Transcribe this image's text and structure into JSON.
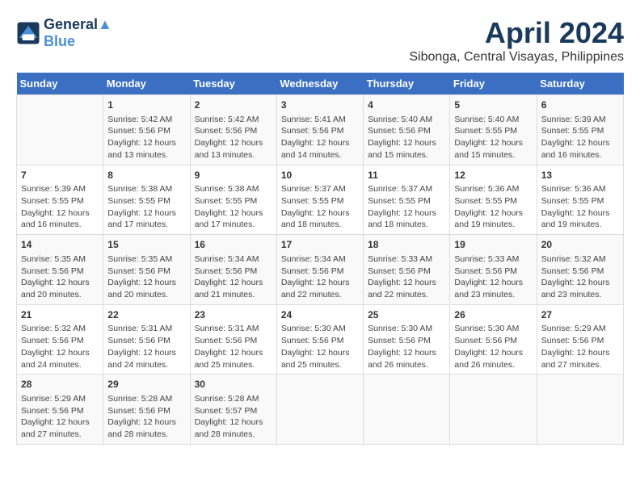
{
  "header": {
    "logo_line1": "General",
    "logo_line2": "Blue",
    "month": "April 2024",
    "location": "Sibonga, Central Visayas, Philippines"
  },
  "days_of_week": [
    "Sunday",
    "Monday",
    "Tuesday",
    "Wednesday",
    "Thursday",
    "Friday",
    "Saturday"
  ],
  "weeks": [
    [
      {
        "day": "",
        "content": ""
      },
      {
        "day": "1",
        "content": "Sunrise: 5:42 AM\nSunset: 5:56 PM\nDaylight: 12 hours\nand 13 minutes."
      },
      {
        "day": "2",
        "content": "Sunrise: 5:42 AM\nSunset: 5:56 PM\nDaylight: 12 hours\nand 13 minutes."
      },
      {
        "day": "3",
        "content": "Sunrise: 5:41 AM\nSunset: 5:56 PM\nDaylight: 12 hours\nand 14 minutes."
      },
      {
        "day": "4",
        "content": "Sunrise: 5:40 AM\nSunset: 5:56 PM\nDaylight: 12 hours\nand 15 minutes."
      },
      {
        "day": "5",
        "content": "Sunrise: 5:40 AM\nSunset: 5:55 PM\nDaylight: 12 hours\nand 15 minutes."
      },
      {
        "day": "6",
        "content": "Sunrise: 5:39 AM\nSunset: 5:55 PM\nDaylight: 12 hours\nand 16 minutes."
      }
    ],
    [
      {
        "day": "7",
        "content": "Sunrise: 5:39 AM\nSunset: 5:55 PM\nDaylight: 12 hours\nand 16 minutes."
      },
      {
        "day": "8",
        "content": "Sunrise: 5:38 AM\nSunset: 5:55 PM\nDaylight: 12 hours\nand 17 minutes."
      },
      {
        "day": "9",
        "content": "Sunrise: 5:38 AM\nSunset: 5:55 PM\nDaylight: 12 hours\nand 17 minutes."
      },
      {
        "day": "10",
        "content": "Sunrise: 5:37 AM\nSunset: 5:55 PM\nDaylight: 12 hours\nand 18 minutes."
      },
      {
        "day": "11",
        "content": "Sunrise: 5:37 AM\nSunset: 5:55 PM\nDaylight: 12 hours\nand 18 minutes."
      },
      {
        "day": "12",
        "content": "Sunrise: 5:36 AM\nSunset: 5:55 PM\nDaylight: 12 hours\nand 19 minutes."
      },
      {
        "day": "13",
        "content": "Sunrise: 5:36 AM\nSunset: 5:55 PM\nDaylight: 12 hours\nand 19 minutes."
      }
    ],
    [
      {
        "day": "14",
        "content": "Sunrise: 5:35 AM\nSunset: 5:56 PM\nDaylight: 12 hours\nand 20 minutes."
      },
      {
        "day": "15",
        "content": "Sunrise: 5:35 AM\nSunset: 5:56 PM\nDaylight: 12 hours\nand 20 minutes."
      },
      {
        "day": "16",
        "content": "Sunrise: 5:34 AM\nSunset: 5:56 PM\nDaylight: 12 hours\nand 21 minutes."
      },
      {
        "day": "17",
        "content": "Sunrise: 5:34 AM\nSunset: 5:56 PM\nDaylight: 12 hours\nand 22 minutes."
      },
      {
        "day": "18",
        "content": "Sunrise: 5:33 AM\nSunset: 5:56 PM\nDaylight: 12 hours\nand 22 minutes."
      },
      {
        "day": "19",
        "content": "Sunrise: 5:33 AM\nSunset: 5:56 PM\nDaylight: 12 hours\nand 23 minutes."
      },
      {
        "day": "20",
        "content": "Sunrise: 5:32 AM\nSunset: 5:56 PM\nDaylight: 12 hours\nand 23 minutes."
      }
    ],
    [
      {
        "day": "21",
        "content": "Sunrise: 5:32 AM\nSunset: 5:56 PM\nDaylight: 12 hours\nand 24 minutes."
      },
      {
        "day": "22",
        "content": "Sunrise: 5:31 AM\nSunset: 5:56 PM\nDaylight: 12 hours\nand 24 minutes."
      },
      {
        "day": "23",
        "content": "Sunrise: 5:31 AM\nSunset: 5:56 PM\nDaylight: 12 hours\nand 25 minutes."
      },
      {
        "day": "24",
        "content": "Sunrise: 5:30 AM\nSunset: 5:56 PM\nDaylight: 12 hours\nand 25 minutes."
      },
      {
        "day": "25",
        "content": "Sunrise: 5:30 AM\nSunset: 5:56 PM\nDaylight: 12 hours\nand 26 minutes."
      },
      {
        "day": "26",
        "content": "Sunrise: 5:30 AM\nSunset: 5:56 PM\nDaylight: 12 hours\nand 26 minutes."
      },
      {
        "day": "27",
        "content": "Sunrise: 5:29 AM\nSunset: 5:56 PM\nDaylight: 12 hours\nand 27 minutes."
      }
    ],
    [
      {
        "day": "28",
        "content": "Sunrise: 5:29 AM\nSunset: 5:56 PM\nDaylight: 12 hours\nand 27 minutes."
      },
      {
        "day": "29",
        "content": "Sunrise: 5:28 AM\nSunset: 5:56 PM\nDaylight: 12 hours\nand 28 minutes."
      },
      {
        "day": "30",
        "content": "Sunrise: 5:28 AM\nSunset: 5:57 PM\nDaylight: 12 hours\nand 28 minutes."
      },
      {
        "day": "",
        "content": ""
      },
      {
        "day": "",
        "content": ""
      },
      {
        "day": "",
        "content": ""
      },
      {
        "day": "",
        "content": ""
      }
    ]
  ]
}
